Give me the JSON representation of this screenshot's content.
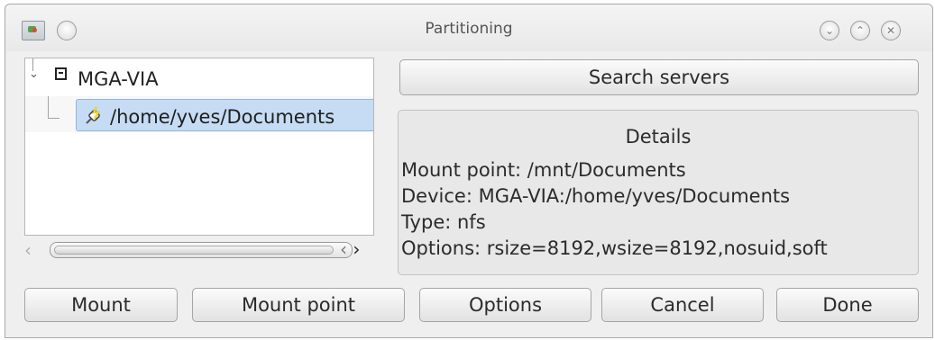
{
  "window": {
    "title": "Partitioning"
  },
  "tree": {
    "root_label": "MGA-VIA",
    "items": [
      {
        "label": "/home/yves/Documents"
      }
    ]
  },
  "right": {
    "search_button": "Search servers",
    "details": {
      "title": "Details",
      "lines": [
        "Mount point: /mnt/Documents",
        "Device: MGA-VIA:/home/yves/Documents",
        "Type: nfs",
        "Options: rsize=8192,wsize=8192,nosuid,soft"
      ]
    }
  },
  "buttons": {
    "mount": "Mount",
    "mount_point": "Mount point",
    "options": "Options",
    "cancel": "Cancel",
    "done": "Done"
  },
  "icons": {
    "title_menu": "app-menu-icon",
    "minimize": "minimize-icon",
    "maximize": "maximize-icon",
    "close": "close-icon"
  },
  "colors": {
    "selection": "#c6dcf4",
    "selection_border": "#8eb5e3",
    "window_bg": "#efefef"
  }
}
